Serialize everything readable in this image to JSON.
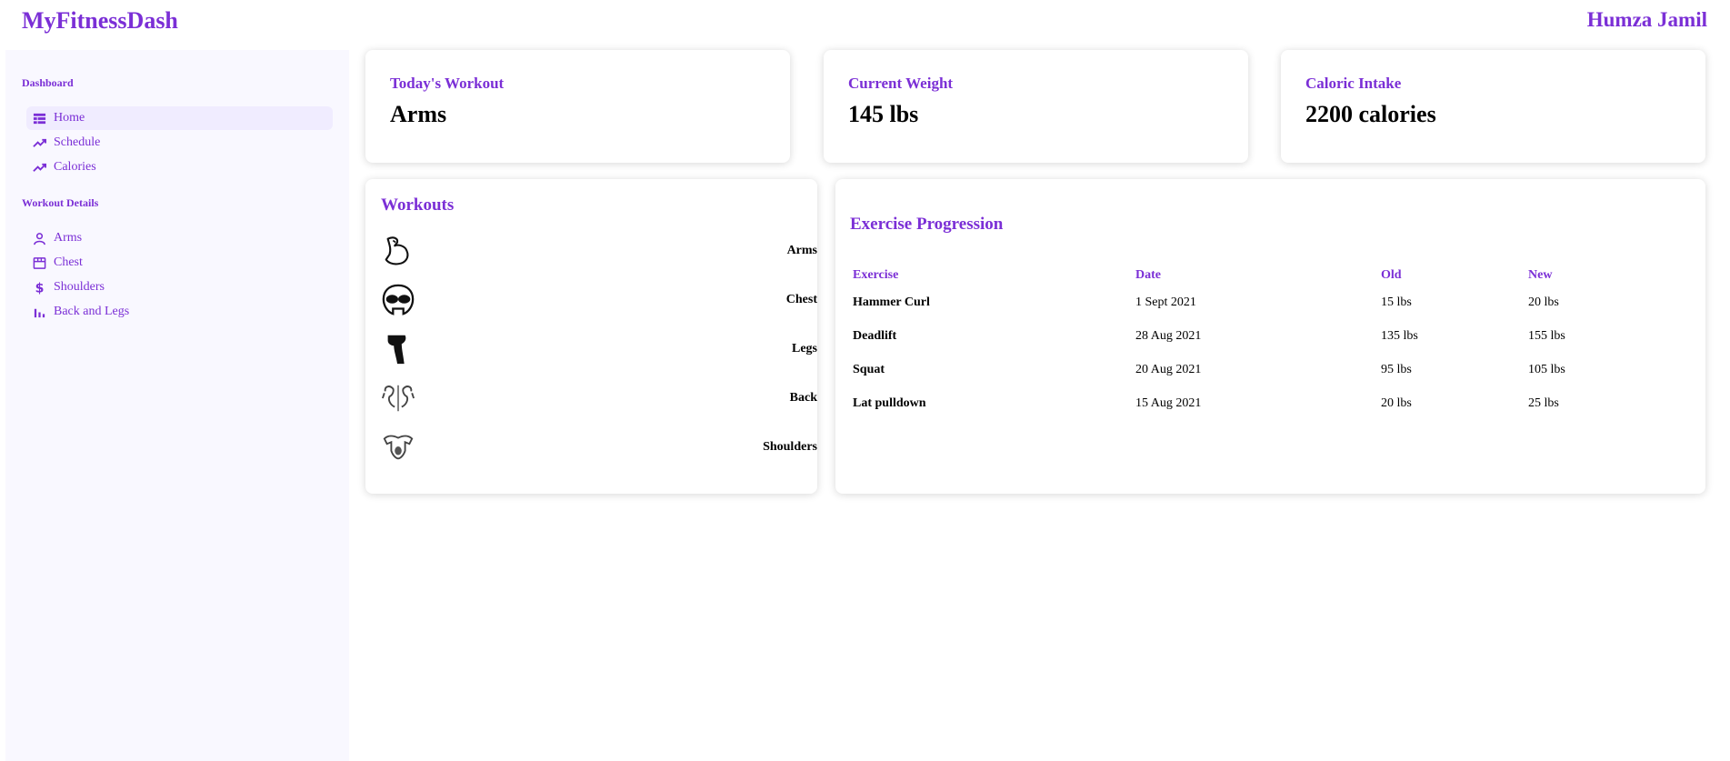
{
  "app": {
    "brand": "MyFitnessDash",
    "user_name": "Humza Jamil"
  },
  "sidebar": {
    "sections": [
      {
        "title": "Dashboard",
        "items": [
          {
            "label": "Home",
            "icon": "table-icon",
            "active": true
          },
          {
            "label": "Schedule",
            "icon": "trending-icon"
          },
          {
            "label": "Calories",
            "icon": "trending-icon"
          }
        ]
      },
      {
        "title": "Workout Details",
        "items": [
          {
            "label": "Arms",
            "icon": "person-icon"
          },
          {
            "label": "Chest",
            "icon": "store-icon"
          },
          {
            "label": "Shoulders",
            "icon": "dollar-icon"
          },
          {
            "label": "Back and Legs",
            "icon": "bar-chart-icon"
          }
        ]
      }
    ]
  },
  "stats": [
    {
      "label": "Today's Workout",
      "value": "Arms"
    },
    {
      "label": "Current Weight",
      "value": "145 lbs"
    },
    {
      "label": "Caloric Intake",
      "value": "2200 calories"
    }
  ],
  "workouts": {
    "title": "Workouts",
    "items": [
      {
        "name": "Arms",
        "icon": "bicep-icon"
      },
      {
        "name": "Chest",
        "icon": "chest-icon"
      },
      {
        "name": "Legs",
        "icon": "leg-icon"
      },
      {
        "name": "Back",
        "icon": "back-icon"
      },
      {
        "name": "Shoulders",
        "icon": "shoulders-icon"
      }
    ]
  },
  "progression": {
    "title": "Exercise Progression",
    "columns": [
      "Exercise",
      "Date",
      "Old",
      "New"
    ],
    "rows": [
      [
        "Hammer Curl",
        "1 Sept 2021",
        "15 lbs",
        "20 lbs"
      ],
      [
        "Deadlift",
        "28 Aug 2021",
        "135 lbs",
        "155 lbs"
      ],
      [
        "Squat",
        "20 Aug 2021",
        "95 lbs",
        "105 lbs"
      ],
      [
        "Lat pulldown",
        "15 Aug 2021",
        "20 lbs",
        "25 lbs"
      ]
    ]
  },
  "colors": {
    "accent": "#7b2fd6",
    "sidebar_bg": "#f9f8ff",
    "active_bg": "#f0ecff"
  }
}
